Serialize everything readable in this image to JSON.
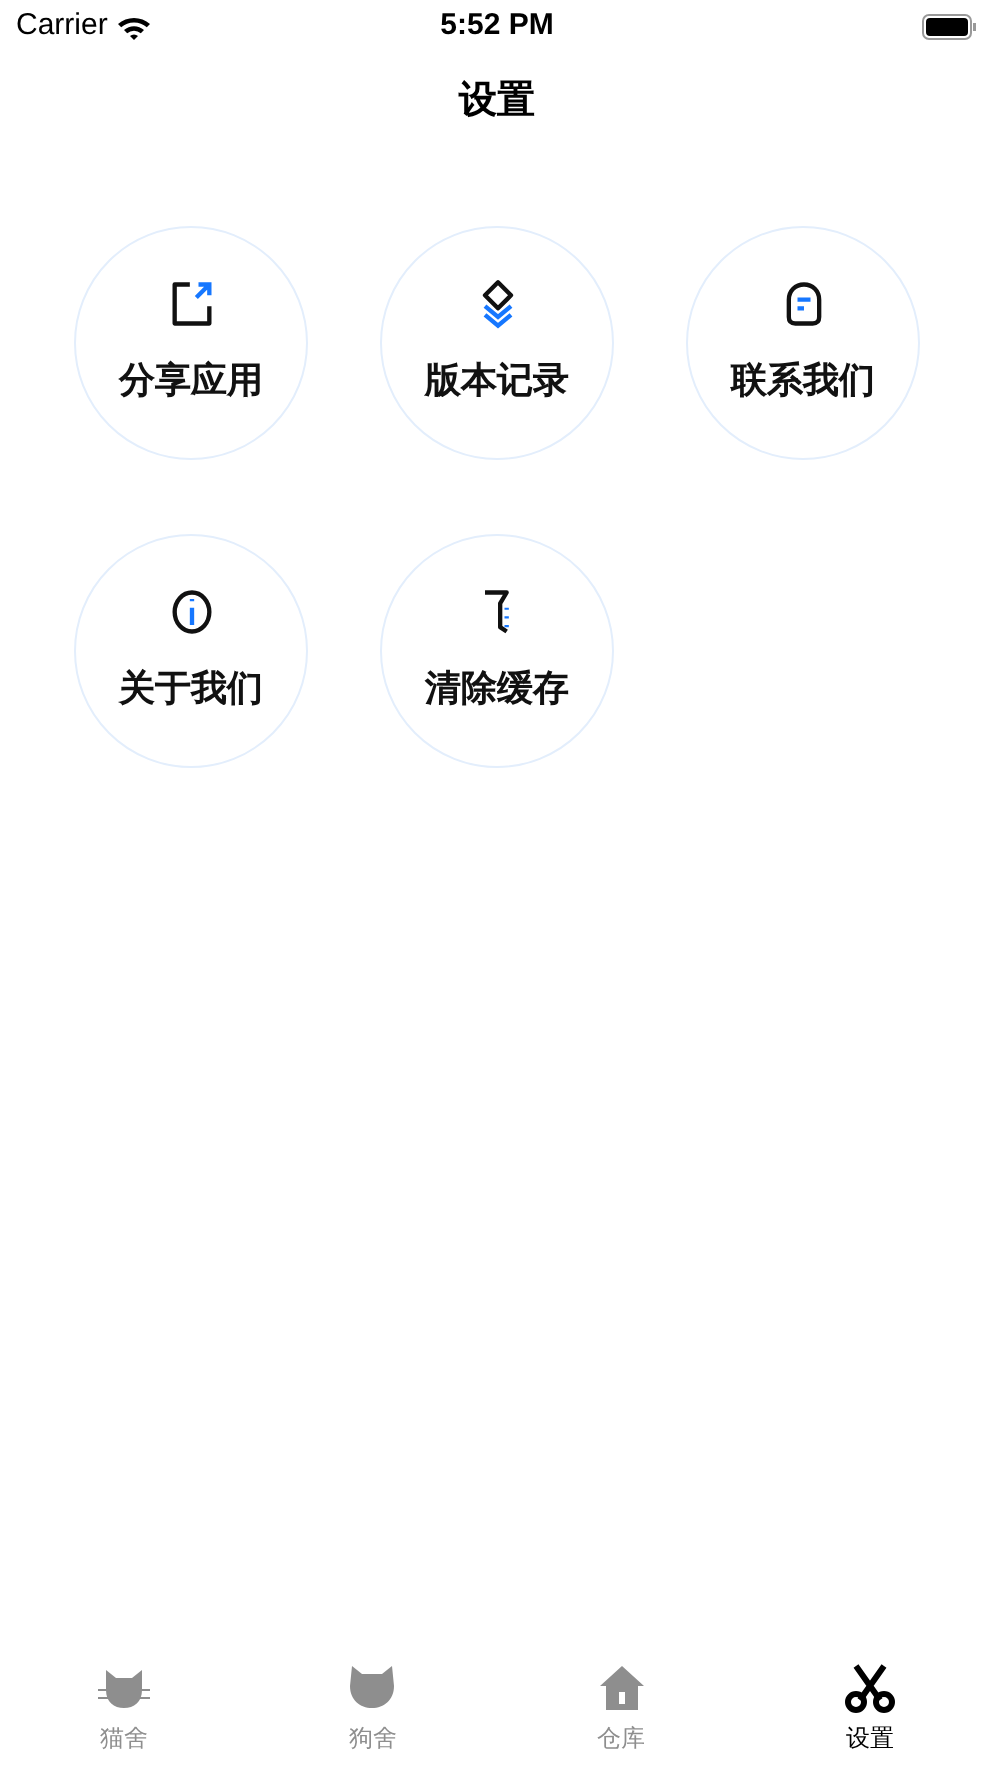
{
  "status_bar": {
    "carrier": "Carrier",
    "time": "5:52 PM"
  },
  "nav": {
    "title": "设置"
  },
  "items": [
    {
      "kind": "share",
      "label": "分享应用"
    },
    {
      "kind": "layers",
      "label": "版本记录"
    },
    {
      "kind": "chat",
      "label": "联系我们"
    },
    {
      "kind": "info",
      "label": "关于我们"
    },
    {
      "kind": "broom",
      "label": "清除缓存"
    }
  ],
  "tabs": [
    {
      "kind": "cat",
      "label": "猫舍",
      "selected": false
    },
    {
      "kind": "dog",
      "label": "狗舍",
      "selected": false
    },
    {
      "kind": "house",
      "label": "仓库",
      "selected": false
    },
    {
      "kind": "scissors",
      "label": "设置",
      "selected": true
    }
  ]
}
